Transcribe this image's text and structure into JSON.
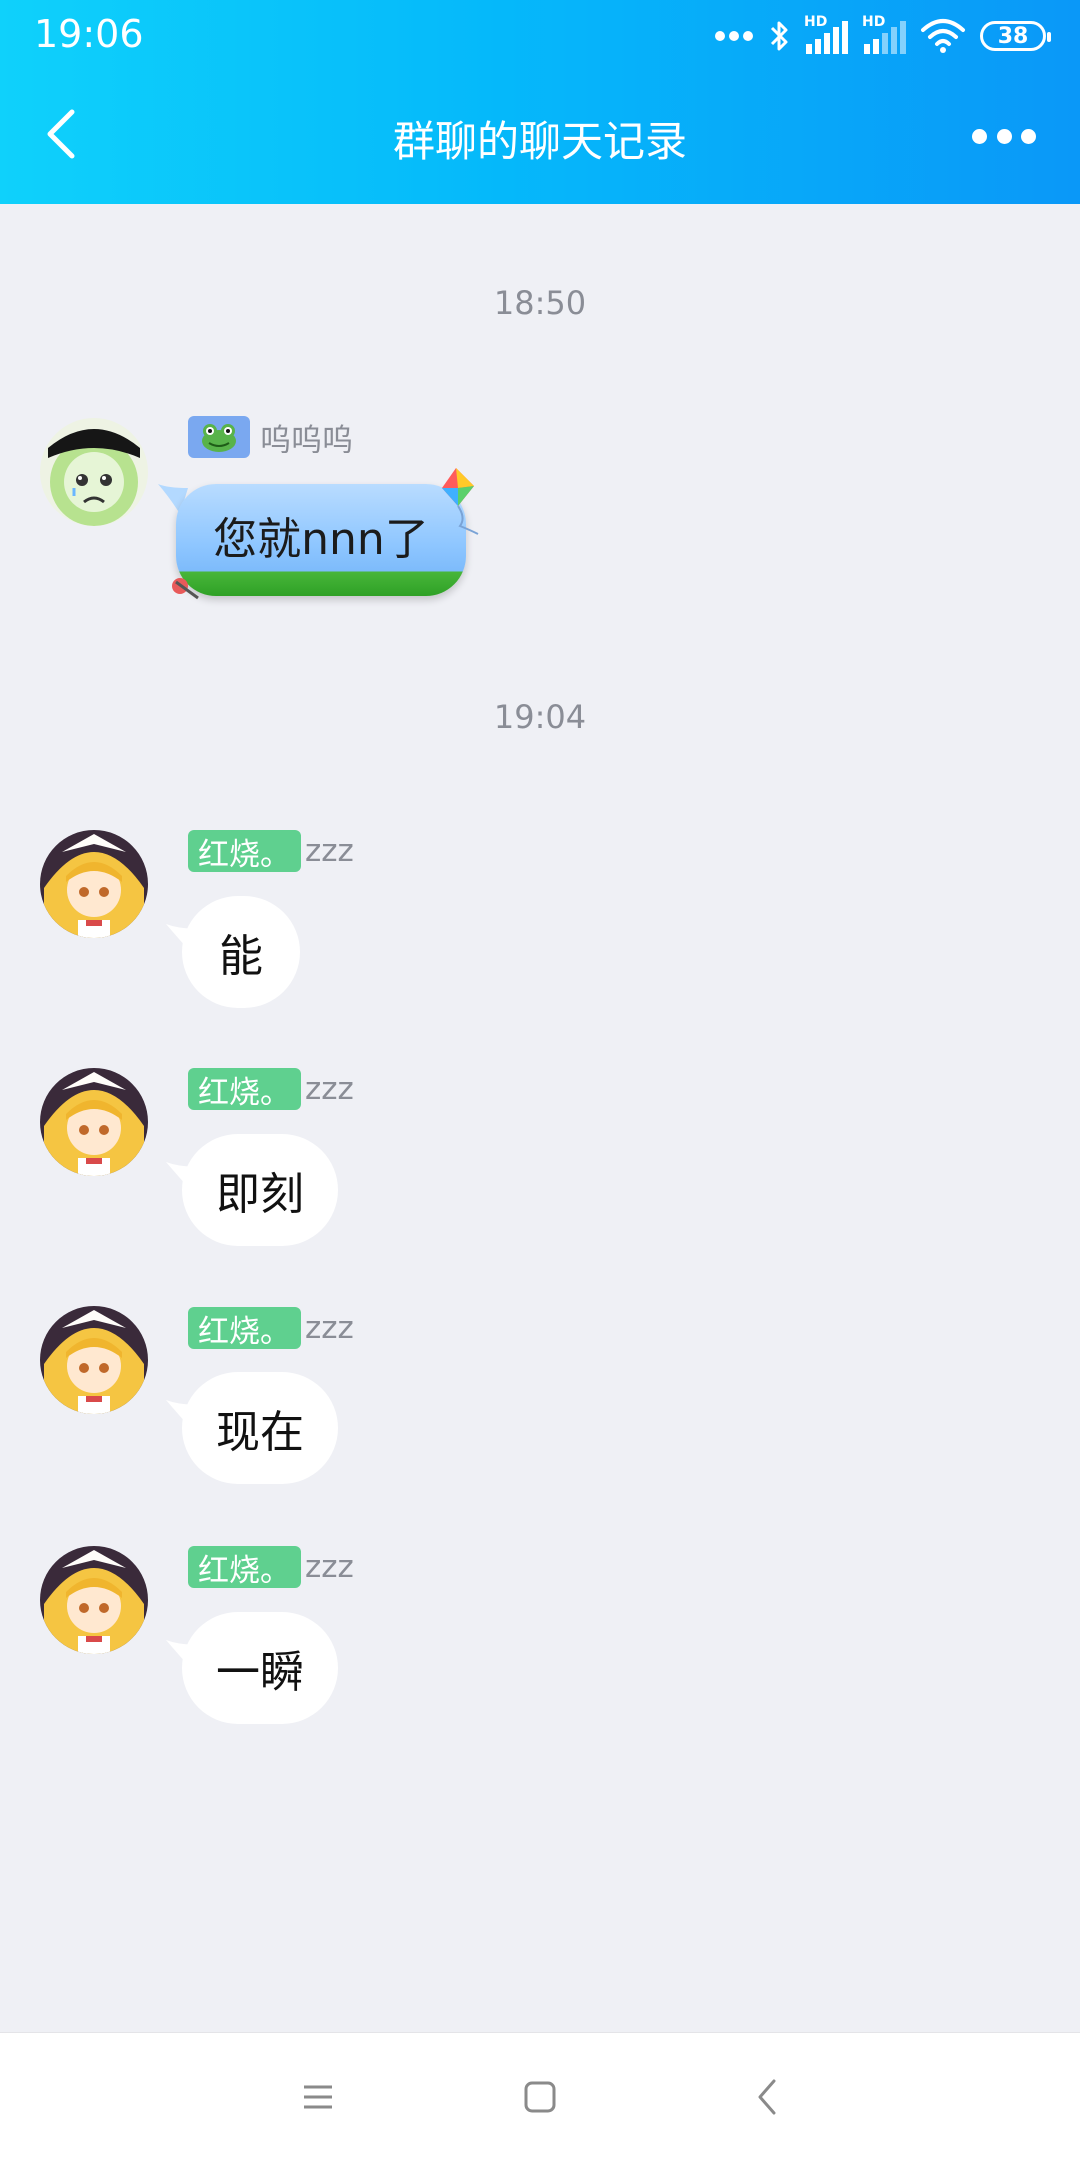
{
  "status_bar": {
    "time": "19:06",
    "battery": "38",
    "signal_label_1": "HD",
    "signal_label_2": "HD"
  },
  "header": {
    "title": "群聊的聊天记录"
  },
  "colors": {
    "accent": "#05b9fa",
    "badge_green": "#5fd08f",
    "background": "#eff0f5"
  },
  "messages": [
    {
      "time_divider": "18:50"
    },
    {
      "sender_badge_icon": "frog-icon",
      "sender": "呜呜呜",
      "text": "您就nnn了",
      "bubble_style": "kite-theme"
    },
    {
      "time_divider": "19:04"
    },
    {
      "sender_badge": "红烧。",
      "sender": "zzz",
      "text": "能"
    },
    {
      "sender_badge": "红烧。",
      "sender": "zzz",
      "text": "即刻"
    },
    {
      "sender_badge": "红烧。",
      "sender": "zzz",
      "text": "现在"
    },
    {
      "sender_badge": "红烧。",
      "sender": "zzz",
      "text": "一瞬"
    }
  ],
  "bottom_nav": {
    "icons": [
      "menu-icon",
      "home-icon",
      "back-triangle-icon"
    ]
  }
}
